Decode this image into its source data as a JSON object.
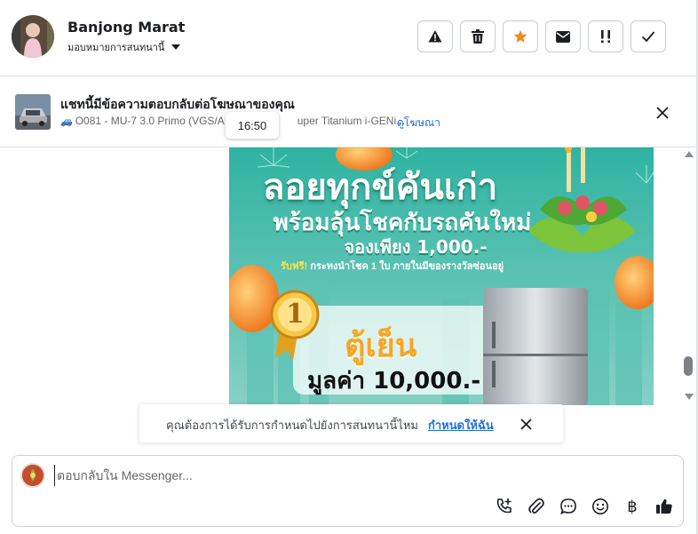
{
  "header": {
    "contact_name": "Banjong Marat",
    "assign_label": "มอบหมายการสนทนานี้",
    "toolbar": [
      {
        "name": "report-button",
        "icon": "warning-icon"
      },
      {
        "name": "delete-button",
        "icon": "trash-icon"
      },
      {
        "name": "star-button",
        "icon": "star-icon",
        "color": "#f28b1b"
      },
      {
        "name": "mark-unread-button",
        "icon": "envelope-icon"
      },
      {
        "name": "follow-up-button",
        "icon": "double-exclamation-icon"
      },
      {
        "name": "mark-done-button",
        "icon": "checkmark-icon"
      }
    ]
  },
  "ad_context": {
    "title": "แชทนี้มีข้อความตอบกลับต่อโฆษณาของคุณ",
    "subtitle": "O081 - MU-7 3.0 Primo (VGS/A",
    "subtitle_tail": "uper Titanium i-GENi...",
    "view_ad_link": "ดูโฆษณา",
    "time_tooltip": "16:50"
  },
  "banner": {
    "line1": "ลอยทุกข์คันเก่า",
    "line2": "พร้อมลุ้นโชคกับรถคันใหม่",
    "line3": "จองเพียง 1,000.-",
    "promo_highlight": "รับฟรี!",
    "promo_text": "กระทงนำโชค 1 ใบ ภายในมีของรางวัลซ่อนอยู่",
    "badge_number": "1",
    "fridge_name": "ตู้เย็น",
    "fridge_value": "มูลค่า 10,000.-"
  },
  "assign_prompt": {
    "text": "คุณต้องการได้รับการกำหนดไปยังการสนทนานี้ไหม",
    "link": "กำหนดให้ฉัน"
  },
  "composer": {
    "placeholder": "ตอบกลับใน Messenger...",
    "tools": [
      "call-add-icon",
      "paperclip-icon",
      "chat-bubble-icon",
      "emoji-icon",
      "baht-icon",
      "thumbs-up-icon"
    ],
    "baht_symbol": "฿"
  },
  "colors": {
    "accent_link": "#216fdb",
    "star": "#f28b1b",
    "banner_bg": "#3eb9a8"
  }
}
